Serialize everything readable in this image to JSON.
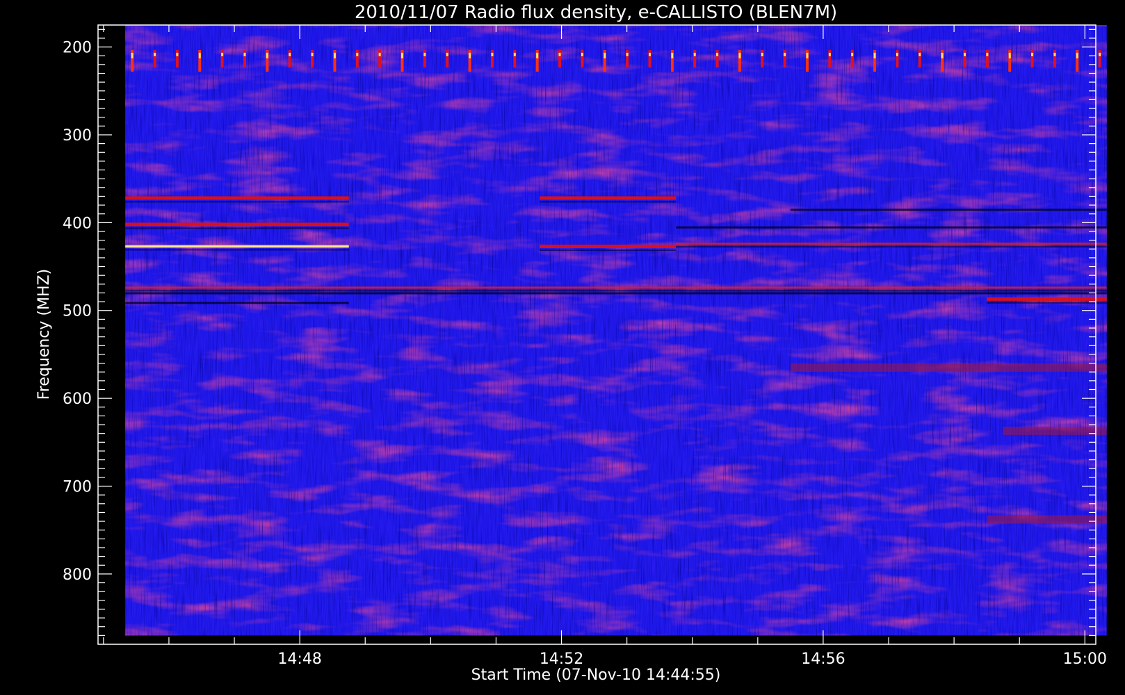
{
  "chart_data": {
    "type": "heatmap",
    "title": "2010/11/07  Radio flux density, e-CALLISTO (BLEN7M)",
    "xlabel": "Start Time (07-Nov-10 14:44:55)",
    "ylabel": "Frequency (MHZ)",
    "x_axis": {
      "unit": "time of day",
      "range": [
        "14:44:55",
        "15:00:10"
      ],
      "tick_labels": [
        "14:48",
        "14:52",
        "14:56",
        "15:00"
      ],
      "minor_tick_interval_seconds": 60
    },
    "y_axis": {
      "unit": "MHz",
      "range": [
        880,
        175
      ],
      "inverted": true,
      "tick_labels": [
        "200",
        "300",
        "400",
        "500",
        "600",
        "700",
        "800"
      ],
      "minor_tick_interval": 10
    },
    "data_range": {
      "freq_mhz": [
        175,
        870
      ],
      "time": [
        "14:45:20",
        "15:00:20"
      ]
    },
    "colormap": [
      "#00008c",
      "#1010e8",
      "#3030ff",
      "#8a1a6a",
      "#c81010",
      "#ff5000",
      "#ffd000",
      "#ffffff"
    ],
    "features": [
      {
        "kind": "periodic-bursts",
        "freq_mhz": [
          205,
          225
        ],
        "time": [
          "14:45:20",
          "15:00:20"
        ]
      },
      {
        "kind": "band",
        "freq_mhz": 372,
        "time": [
          "14:45:20",
          "14:48:45"
        ],
        "level": "high"
      },
      {
        "kind": "band",
        "freq_mhz": 402,
        "time": [
          "14:45:20",
          "14:48:45"
        ],
        "level": "high"
      },
      {
        "kind": "band",
        "freq_mhz": 427,
        "time": [
          "14:45:20",
          "14:48:45"
        ],
        "level": "very high"
      },
      {
        "kind": "band",
        "freq_mhz": 372,
        "time": [
          "14:51:40",
          "14:53:45"
        ],
        "level": "high"
      },
      {
        "kind": "band",
        "freq_mhz": 427,
        "time": [
          "14:51:40",
          "14:53:45"
        ],
        "level": "high"
      },
      {
        "kind": "band",
        "freq_mhz": 424,
        "time": [
          "14:53:45",
          "15:00:20"
        ],
        "level": "medium"
      },
      {
        "kind": "band",
        "freq_mhz": 474,
        "time": [
          "14:45:20",
          "15:00:20"
        ],
        "level": "medium"
      },
      {
        "kind": "band",
        "freq_mhz": 487,
        "time": [
          "14:58:30",
          "15:00:20"
        ],
        "level": "high"
      },
      {
        "kind": "band",
        "freq_mhz": 565,
        "time": [
          "14:55:30",
          "15:00:20"
        ],
        "level": "low"
      },
      {
        "kind": "band",
        "freq_mhz": 637,
        "time": [
          "14:58:45",
          "15:00:20"
        ],
        "level": "low"
      },
      {
        "kind": "band",
        "freq_mhz": 738,
        "time": [
          "14:58:30",
          "15:00:20"
        ],
        "level": "low"
      }
    ]
  }
}
